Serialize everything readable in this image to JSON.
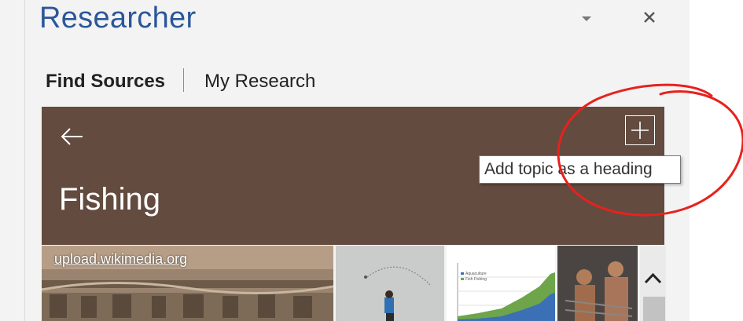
{
  "pane": {
    "title": "Researcher"
  },
  "tabs": [
    {
      "label": "Find Sources",
      "active": true
    },
    {
      "label": "My Research",
      "active": false
    }
  ],
  "topic": {
    "title": "Fishing",
    "banner_color": "#634b40"
  },
  "tooltip": {
    "text": "Add topic as a heading"
  },
  "images": {
    "source": "upload.wikimedia.org",
    "chart_legend": [
      "Aquaculture",
      "Fish Fishing"
    ]
  },
  "colors": {
    "title": "#2b579a",
    "annotation": "#e8211d"
  }
}
